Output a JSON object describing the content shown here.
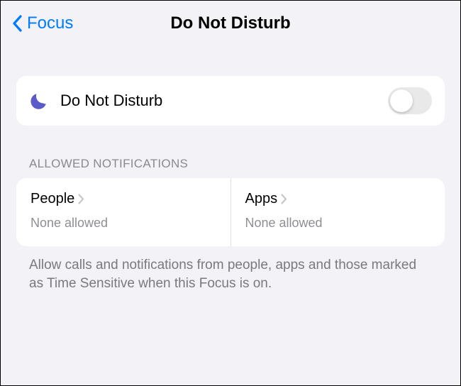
{
  "header": {
    "back_label": "Focus",
    "title": "Do Not Disturb"
  },
  "dnd": {
    "label": "Do Not Disturb",
    "enabled": false
  },
  "allowed_notifications": {
    "section_label": "Allowed Notifications",
    "people": {
      "label": "People",
      "status": "None allowed"
    },
    "apps": {
      "label": "Apps",
      "status": "None allowed"
    }
  },
  "footer_text": "Allow calls and notifications from people, apps and those marked as Time Sensitive when this Focus is on.",
  "colors": {
    "accent": "#007aff",
    "moon": "#5a5ac9"
  }
}
